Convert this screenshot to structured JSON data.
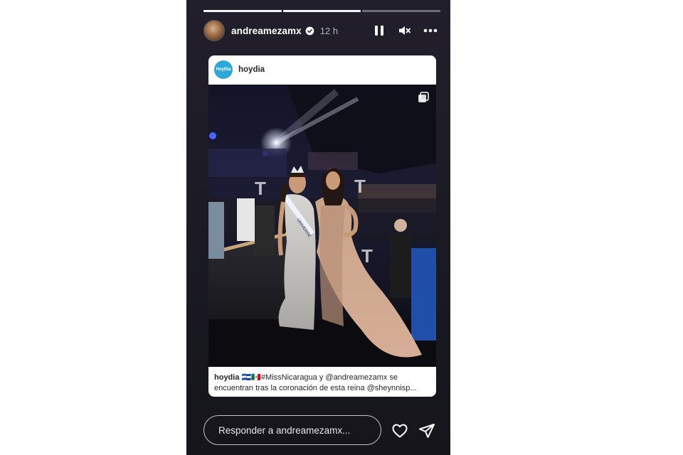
{
  "story": {
    "progress_segments": 3,
    "progress_done": 2,
    "user": {
      "username": "andreamezamx",
      "verified": true,
      "time_ago": "12 h"
    },
    "controls": {
      "pause_icon": "pause-icon",
      "mute_icon": "volume-muted-icon",
      "more_icon": "more-icon"
    }
  },
  "shared_post": {
    "account": "hoydia",
    "avatar_text": "HoyDía",
    "caption_user": "hoydia",
    "caption_flags": "🇸🇻🇲🇽",
    "caption_text": "#MissNicaragua y @andreamezamx se encuentran tras la coronación de esta reina @sheynnisp...",
    "sash_text": "UNIVERSE",
    "watermark": "T"
  },
  "reply": {
    "placeholder": "Responder a andreamezamx..."
  },
  "colors": {
    "story_bg": "#1c1b24",
    "card_bg": "#ffffff",
    "avatar_blue": "#2fa8d8"
  }
}
